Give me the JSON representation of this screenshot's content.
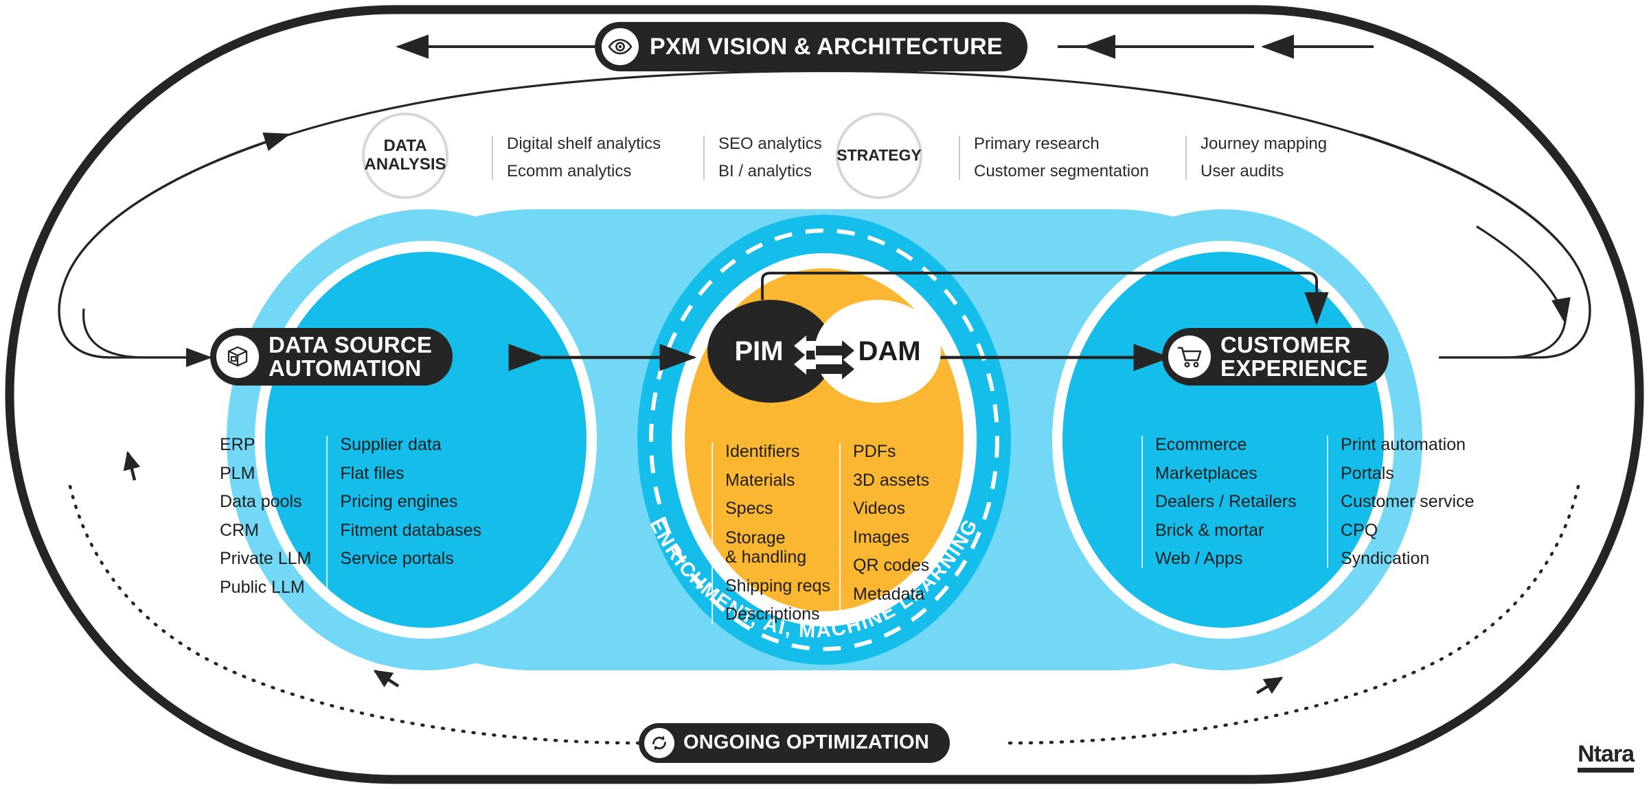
{
  "diagram": {
    "title": "PXM VISION & ARCHITECTURE",
    "footer": "ONGOING OPTIMIZATION",
    "center_ring_text": "ENRICHMENT, AI, MACHINE LEARNING",
    "brand": "Ntara"
  },
  "colors": {
    "ink": "#252525",
    "blue_light": "#73D8F5",
    "blue_mid": "#15BEEA",
    "yellow": "#FBB731",
    "white": "#FFFFFF",
    "grey_rule": "#C9C9C9"
  },
  "header": {
    "label": "PXM VISION & ARCHITECTURE",
    "icon": "eye-icon"
  },
  "top_groups": [
    {
      "id": "data-analysis",
      "badge": "DATA\nANALYSIS",
      "badge_line1": "DATA",
      "badge_line2": "ANALYSIS",
      "columns": [
        [
          "Digital shelf analytics",
          "Ecomm analytics"
        ],
        [
          "SEO analytics",
          "BI / analytics"
        ]
      ]
    },
    {
      "id": "strategy",
      "badge": "STRATEGY",
      "badge_line1": "STRATEGY",
      "badge_line2": "",
      "columns": [
        [
          "Primary research",
          "Customer segmentation"
        ],
        [
          "Journey mapping",
          "User audits"
        ]
      ]
    }
  ],
  "stacks": [
    {
      "id": "data-source-automation",
      "pill_line1": "DATA SOURCE",
      "pill_line2": "AUTOMATION",
      "icon": "package-box-icon",
      "columns": [
        [
          "ERP",
          "PLM",
          "Data pools",
          "CRM",
          "Private LLM",
          "Public LLM"
        ],
        [
          "Supplier data",
          "Flat files",
          "Pricing engines",
          "Fitment databases",
          "Service portals"
        ]
      ]
    },
    {
      "id": "pim-dam",
      "node_left": "PIM",
      "node_right": "DAM",
      "ring_text": "ENRICHMENT, AI, MACHINE LEARNING",
      "columns": [
        [
          "Identifiers",
          "Materials",
          "Specs",
          "Storage\n& handling",
          "Shipping reqs",
          "Descriptions"
        ],
        [
          "PDFs",
          "3D assets",
          "Videos",
          "Images",
          "QR codes",
          "Metadata"
        ]
      ]
    },
    {
      "id": "customer-experience",
      "pill_line1": "CUSTOMER",
      "pill_line2": "EXPERIENCE",
      "icon": "shopping-cart-icon",
      "columns": [
        [
          "Ecommerce",
          "Marketplaces",
          "Dealers / Retailers",
          "Brick & mortar",
          "Web / Apps"
        ],
        [
          "Print automation",
          "Portals",
          "Customer service",
          "CPQ",
          "Syndication"
        ]
      ]
    }
  ],
  "footer": {
    "label": "ONGOING OPTIMIZATION",
    "icon": "refresh-sync-icon"
  },
  "brand": {
    "name": "Ntara"
  }
}
